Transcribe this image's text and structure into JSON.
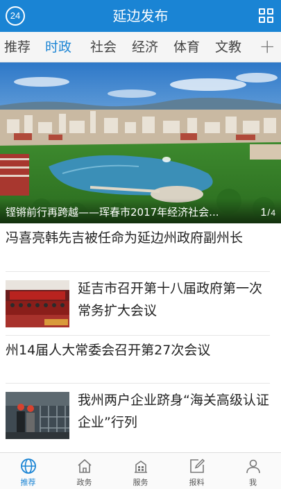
{
  "header": {
    "logo_text": "24",
    "title": "延边发布"
  },
  "tabs": [
    {
      "label": "推荐"
    },
    {
      "label": "时政"
    },
    {
      "label": "社会"
    },
    {
      "label": "经济"
    },
    {
      "label": "体育"
    },
    {
      "label": "文教"
    }
  ],
  "tabs_add": "+",
  "banner": {
    "caption": "铿锵前行再跨越——珲春市2017年经济社会...",
    "page_current": "1",
    "page_separator": "/",
    "page_total": "4"
  },
  "news": [
    {
      "title": "冯喜亮韩先吉被任命为延边州政府副州长"
    },
    {
      "title": "延吉市召开第十八届政府第一次常务扩大会议"
    },
    {
      "title": "州14届人大常委会召开第27次会议"
    },
    {
      "title": "我州两户企业跻身“海关高级认证企业”行列"
    }
  ],
  "bottom_nav": [
    {
      "label": "推荐",
      "icon": "globe-icon"
    },
    {
      "label": "政务",
      "icon": "home-icon"
    },
    {
      "label": "服务",
      "icon": "building-icon"
    },
    {
      "label": "报料",
      "icon": "edit-icon"
    },
    {
      "label": "我",
      "icon": "user-icon"
    }
  ],
  "colors": {
    "accent": "#1a84d4",
    "tab_bar_bg": "#f5f5f5",
    "text": "#222222"
  }
}
